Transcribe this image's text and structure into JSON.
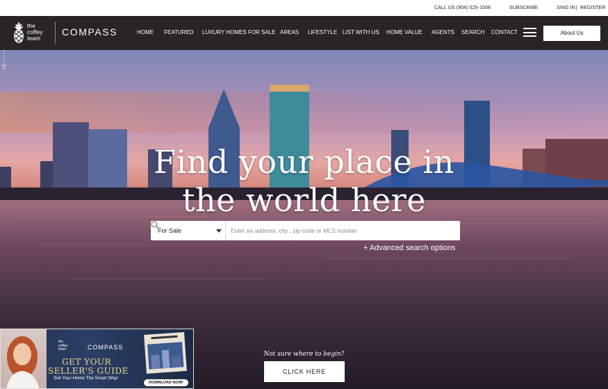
{
  "topbar": {
    "call": "CALL US (904) 525-1008",
    "subscribe": "SUBSCRIBE",
    "sign_in": "SING IN",
    "separator": "|",
    "register": "REGISTER"
  },
  "brand": {
    "team_line1": "the",
    "team_line2": "coffey",
    "team_line3": "team",
    "compass": "COMPASS"
  },
  "nav": {
    "items": [
      "HOME",
      "FEATURED",
      "LUXURY HOMES FOR SALE",
      "AREAS",
      "LIFESTYLE",
      "LIST WITH US",
      "HOME VALUE",
      "AGENTS",
      "SEARCH",
      "CONTACT"
    ],
    "about_button": "About Us"
  },
  "hero": {
    "headline_line1": "Find your place in",
    "headline_line2": "the world here",
    "search": {
      "type_selected": "For Sale",
      "placeholder": "Enter an address, city , zip code or MLS number"
    },
    "advanced_link": "+ Advanced search options",
    "prompt": "Not sure where to begin?",
    "cta": "CLICK HERE"
  },
  "banner": {
    "logo_line1": "the",
    "logo_line2": "coffey",
    "logo_line3": "team",
    "compass": "COMPASS",
    "title_line1": "GET YOUR",
    "title_line2": "SELLER'S GUIDE",
    "tagline": "Sell Your Home The Smart Way!",
    "button": "DOWNLOAD NOW!"
  },
  "icons": [
    "pineapple-icon",
    "hamburger-menu-icon",
    "chevron-down-icon",
    "search-icon",
    "scroll-down-icon"
  ],
  "colors": {
    "nav_bg": "#2a2424",
    "accent_gold": "#f2d890"
  }
}
